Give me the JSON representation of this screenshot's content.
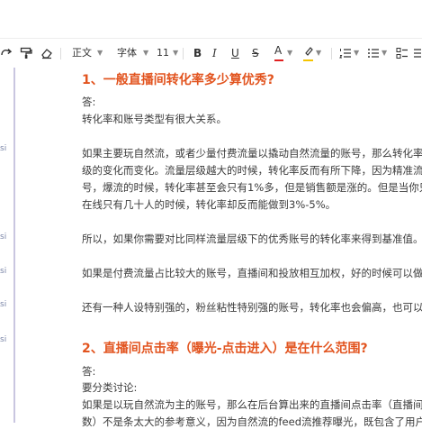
{
  "toolbar": {
    "paragraph_style": "正文",
    "font_family": "字体",
    "font_size": "11",
    "bold": "B",
    "italic": "I",
    "underline": "U",
    "strikethrough": "S",
    "font_color": "A",
    "colors": {
      "font_color_bar": "#e02020",
      "highlight_bar": "#f5c400",
      "accent": "#e2541f"
    }
  },
  "margin_labels": [
    "si",
    "si",
    "si",
    "si",
    "si"
  ],
  "doc": {
    "h1": "1、一般直播间转化率多少算优秀?",
    "p1": "答:",
    "p2": "转化率和账号类型有很大关系。",
    "p3_l1": "如果主要玩自然流，或者少量付费流量以撬动自然流量的账号，那么转化率实",
    "p3_l2": "级的变化而变化。流量层级越大的时候，转化率反而有所下降，因为精准流量",
    "p3_l3": "号，爆流的时候，转化率甚至会只有1%多，但是销售额是涨的。但是当你只有",
    "p3_l4": "在线只有几十人的时候，转化率却反而能做到3%-5%。",
    "p4": "所以，如果你需要对比同样流量层级下的优秀账号的转化率来得到基准值。",
    "p5": "如果是付费流量占比较大的账号，直播间和投放相互加权，好的时候可以做到",
    "p6": "还有一种人设特别强的，粉丝粘性特别强的账号，转化率也会偏高，也可以做",
    "h2": "2、直播间点击率（曝光-点击进入）是在什么范围?",
    "p7": "答:",
    "p8": "要分类讨论:",
    "p9_l1": "如果是以玩自然流为主的账号，那么在后台算出来的直播间点击率（直播间观",
    "p9_l2": "数）不是条太大的参考意义，因为自然流的feed流推荐曝光，既包含了用户主"
  }
}
